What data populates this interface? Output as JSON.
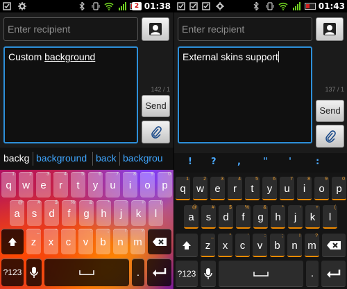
{
  "left": {
    "status": {
      "time": "01:38",
      "badge": "2"
    },
    "recipient_placeholder": "Enter recipient",
    "message_plain": "Custom ",
    "message_underlined": "background",
    "counter": "142 / 1",
    "send_label": "Send",
    "suggestions": {
      "typed": "backg",
      "words": [
        "background",
        "back",
        "backgrou"
      ]
    },
    "rows": [
      [
        "q",
        "w",
        "e",
        "r",
        "t",
        "y",
        "u",
        "i",
        "o",
        "p"
      ],
      [
        "a",
        "s",
        "d",
        "f",
        "g",
        "h",
        "j",
        "k",
        "l"
      ],
      [
        "z",
        "x",
        "c",
        "v",
        "b",
        "n",
        "m"
      ]
    ],
    "sub_labels": {
      "e": "3",
      "r": "4",
      "t": "5",
      "y": "6",
      "u": "7",
      "i": "8",
      "o": "9",
      "p": "0",
      "w": "2",
      "q": "1",
      "s": "#",
      "d": "$",
      "f": "%",
      "g": "&",
      "h": "*",
      "j": "-",
      "k": "+",
      "l": "(",
      "a": "@",
      "z": "_",
      "x": "\"",
      "c": "'",
      "v": ":",
      "b": ";",
      "n": "!",
      "m": "?"
    },
    "symbols_label": "?123"
  },
  "right": {
    "status": {
      "time": "01:43"
    },
    "recipient_placeholder": "Enter recipient",
    "message": "External skins support",
    "counter": "137 / 1",
    "send_label": "Send",
    "punctuation": [
      "!",
      "?",
      ",",
      "\"",
      "'",
      ":"
    ],
    "rows": [
      [
        "q",
        "w",
        "e",
        "r",
        "t",
        "y",
        "u",
        "i",
        "o",
        "p"
      ],
      [
        "a",
        "s",
        "d",
        "f",
        "g",
        "h",
        "j",
        "k",
        "l"
      ],
      [
        "z",
        "x",
        "c",
        "v",
        "b",
        "n",
        "m"
      ]
    ],
    "sub_labels": {
      "q": "1",
      "w": "2",
      "e": "3",
      "r": "4",
      "t": "5",
      "y": "6",
      "u": "7",
      "i": "8",
      "o": "9",
      "p": "0",
      "a": "@",
      "s": "#",
      "d": "$",
      "f": "%",
      "g": "&",
      "h": "*",
      "j": "-",
      "k": "+",
      "l": "(",
      "z": "_",
      "x": "\"",
      "c": "'",
      "v": ":",
      "b": ";",
      "n": "!",
      "m": "?"
    },
    "symbols_label": "?123"
  },
  "icons": [
    "checkbox-icon",
    "gear-icon",
    "bluetooth-icon",
    "vibrate-icon",
    "wifi-icon",
    "signal-icon",
    "battery-icon",
    "contact-icon",
    "paperclip-icon",
    "shift-icon",
    "backspace-icon",
    "microphone-icon",
    "space-icon",
    "enter-icon"
  ],
  "colors": {
    "accent_blue": "#2d8fd9",
    "suggestion_blue": "#3fa6ff",
    "skin_orange": "#f08a00",
    "battery_red": "#d02020"
  }
}
